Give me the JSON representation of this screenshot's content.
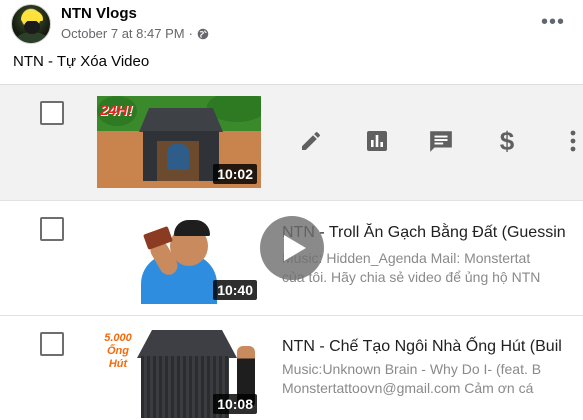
{
  "post": {
    "channel_name": "NTN Vlogs",
    "timestamp": "October 7 at 8:47 PM",
    "dot": "·",
    "privacy_icon": "globe-icon",
    "more_icon": "•••",
    "text": "NTN - Tự Xóa Video"
  },
  "videos": [
    {
      "thumb_badge": "24H!",
      "duration": "10:02",
      "actions": {
        "edit_icon": "pencil-icon",
        "analytics_icon": "bar-chart-icon",
        "comments_icon": "comment-icon",
        "monetization_icon": "dollar-icon",
        "monetization_glyph": "$",
        "options_icon": "vertical-dots-icon"
      }
    },
    {
      "duration": "10:40",
      "title": "NTN - Troll Ăn Gạch Bằng Đất (Guessin",
      "desc_line1": "Music: Hidden_Agenda Mail: Monstertat",
      "desc_line2": "của tôi. Hãy chia sẻ video để ủng hộ NTN"
    },
    {
      "thumb_label": "5.000 Ống Hút",
      "duration": "10:08",
      "title": "NTN - Chế Tạo Ngôi Nhà Ống Hút (Buil",
      "desc_line1": "Music:Unknown Brain - Why Do I- (feat. B",
      "desc_line2": "Monstertattoovn@gmail.com Cảm ơn cá"
    }
  ],
  "overlay": {
    "play_icon": "play-icon"
  }
}
